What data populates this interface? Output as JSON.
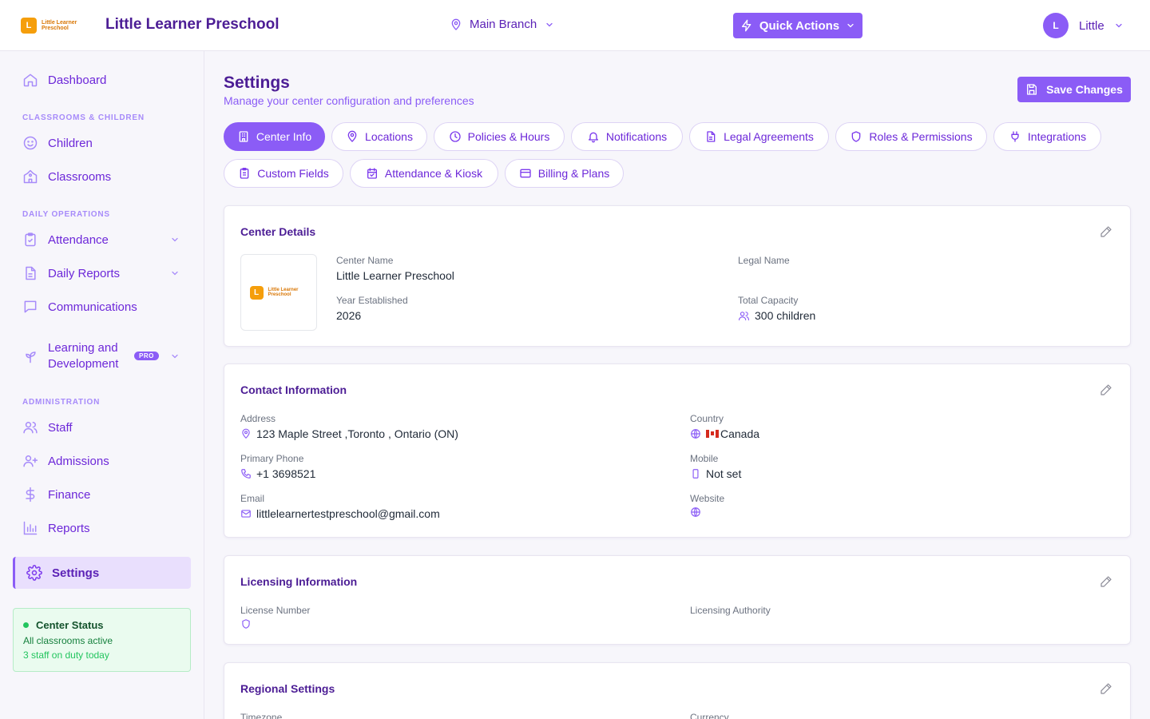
{
  "brand": {
    "logo_letter": "L",
    "logo_text": "Little Learner Preschool",
    "app_title": "Little Learner Preschool"
  },
  "topbar": {
    "branch": "Main Branch",
    "quick_actions": "Quick Actions",
    "user_initial": "L",
    "user_name": "Little"
  },
  "sidebar": {
    "dashboard": "Dashboard",
    "section_classrooms": "CLASSROOMS & CHILDREN",
    "children": "Children",
    "classrooms": "Classrooms",
    "section_daily": "DAILY OPERATIONS",
    "attendance": "Attendance",
    "daily_reports": "Daily Reports",
    "communications": "Communications",
    "learning": "Learning and Development",
    "pro_badge": "PRO",
    "section_admin": "ADMINISTRATION",
    "staff": "Staff",
    "admissions": "Admissions",
    "finance": "Finance",
    "reports": "Reports",
    "settings": "Settings"
  },
  "status_card": {
    "title": "Center Status",
    "line1": "All classrooms active",
    "line2": "3 staff on duty today"
  },
  "page": {
    "title": "Settings",
    "subtitle": "Manage your center configuration and preferences",
    "save": "Save Changes"
  },
  "tabs": [
    {
      "label": "Center Info"
    },
    {
      "label": "Locations"
    },
    {
      "label": "Policies & Hours"
    },
    {
      "label": "Notifications"
    },
    {
      "label": "Legal Agreements"
    },
    {
      "label": "Roles & Permissions"
    },
    {
      "label": "Integrations"
    },
    {
      "label": "Custom Fields"
    },
    {
      "label": "Attendance & Kiosk"
    },
    {
      "label": "Billing & Plans"
    }
  ],
  "center_details": {
    "title": "Center Details",
    "name_label": "Center Name",
    "name": "Little Learner Preschool",
    "legal_label": "Legal Name",
    "year_label": "Year Established",
    "year": "2026",
    "capacity_label": "Total Capacity",
    "capacity": "300 children"
  },
  "contact": {
    "title": "Contact Information",
    "address_label": "Address",
    "address": "123 Maple Street ,Toronto , Ontario (ON)",
    "country_label": "Country",
    "country": "Canada",
    "phone_label": "Primary Phone",
    "phone": "+1 3698521",
    "mobile_label": "Mobile",
    "mobile": "Not set",
    "email_label": "Email",
    "email": "littlelearnertestpreschool@gmail.com",
    "website_label": "Website"
  },
  "licensing": {
    "title": "Licensing Information",
    "number_label": "License Number",
    "authority_label": "Licensing Authority"
  },
  "regional": {
    "title": "Regional Settings",
    "timezone_label": "Timezone",
    "currency_label": "Currency"
  },
  "colors": {
    "accent": "#8b5cf6",
    "accent_dark": "#4c1d95",
    "status_green": "#22c55e"
  }
}
